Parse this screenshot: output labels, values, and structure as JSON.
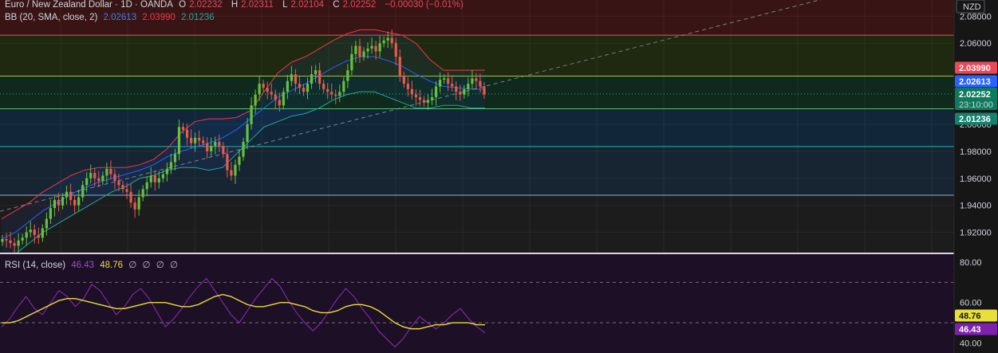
{
  "legend": {
    "symbol": "Euro / New Zealand Dollar · 1D · OANDA",
    "o_label": "O",
    "o_value": "2.02232",
    "h_label": "H",
    "h_value": "2.02311",
    "l_label": "L",
    "l_value": "2.02104",
    "c_label": "C",
    "c_value": "2.02252",
    "change": "−0.00030 (−0.01%)",
    "bb_label": "BB (20, SMA, close, 2)",
    "bb_basis": "2.02613",
    "bb_upper": "2.03990",
    "bb_lower": "2.01236",
    "rsi_label": "RSI (14, close)",
    "rsi_value": "46.43",
    "rsi_ma": "48.76",
    "rsi_extra": [
      "∅",
      "∅",
      "∅",
      "∅"
    ]
  },
  "axis": {
    "currency": "NZD",
    "price_ticks": [
      "2.08000",
      "2.06000",
      "2.00000",
      "1.98000",
      "1.96000",
      "1.94000",
      "1.92000"
    ],
    "rsi_ticks": [
      "80.00",
      "60.00",
      "40.00"
    ],
    "badges": {
      "upper": "2.03990",
      "basis": "2.02613",
      "close": "2.02252",
      "countdown": "23:10:00",
      "lower": "2.01236",
      "rsi_ma": "48.76",
      "rsi": "46.43"
    }
  },
  "colors": {
    "upper_band": "#f23645",
    "basis": "#2962ff",
    "lower_band": "#26a69a",
    "bull": "#66c23a",
    "bear": "#e85a4f",
    "rsi": "#8b2fb8",
    "rsi_ma": "#e8df3a",
    "zone_red": "#3a1414",
    "zone_olive": "#1f2a10",
    "zone_green": "#0f2a1c",
    "zone_teal": "#11273a",
    "rsi_bg": "#1d0f26"
  },
  "chart_data": [
    {
      "type": "candlestick",
      "title": "Euro / New Zealand Dollar · 1D · OANDA",
      "ylim": [
        1.905,
        2.092
      ],
      "y_ticks": [
        2.08,
        2.06,
        2.0,
        1.98,
        1.96,
        1.94,
        1.92
      ],
      "horizontal_levels": [
        2.066,
        2.0357,
        2.0115,
        1.9835,
        1.9475
      ],
      "trendline": {
        "from": [
          0,
          1.9355
        ],
        "to": [
          299,
          2.094
        ]
      },
      "close_series": [
        1.915,
        1.914,
        1.912,
        1.91,
        1.914,
        1.916,
        1.92,
        1.922,
        1.918,
        1.916,
        1.923,
        1.93,
        1.938,
        1.944,
        1.94,
        1.946,
        1.95,
        1.944,
        1.94,
        1.946,
        1.955,
        1.96,
        1.964,
        1.96,
        1.958,
        1.962,
        1.967,
        1.963,
        1.958,
        1.955,
        1.952,
        1.95,
        1.942,
        1.937,
        1.946,
        1.952,
        1.957,
        1.962,
        1.957,
        1.96,
        1.963,
        1.967,
        1.972,
        1.978,
        1.998,
        1.996,
        1.99,
        1.986,
        1.99,
        1.988,
        1.986,
        1.98,
        1.984,
        1.987,
        1.984,
        1.978,
        1.966,
        1.962,
        1.97,
        1.976,
        1.987,
        2.0,
        2.014,
        2.022,
        2.03,
        2.027,
        2.024,
        2.022,
        2.018,
        2.014,
        2.024,
        2.032,
        2.037,
        2.03,
        2.027,
        2.024,
        2.03,
        2.037,
        2.04,
        2.03,
        2.026,
        2.024,
        2.022,
        2.021,
        2.024,
        2.032,
        2.04,
        2.052,
        2.058,
        2.05,
        2.054,
        2.056,
        2.058,
        2.054,
        2.06,
        2.062,
        2.064,
        2.06,
        2.05,
        2.036,
        2.03,
        2.026,
        2.022,
        2.02,
        2.018,
        2.016,
        2.018,
        2.02,
        2.028,
        2.033,
        2.034,
        2.03,
        2.028,
        2.024,
        2.022,
        2.026,
        2.03,
        2.034,
        2.032,
        2.028,
        2.022
      ],
      "bollinger": {
        "upper": [
          1.93,
          1.936,
          1.942,
          1.95,
          1.956,
          1.962,
          1.966,
          1.968,
          1.968,
          1.968,
          1.97,
          1.974,
          1.982,
          1.994,
          2.002,
          2.004,
          2.004,
          2.005,
          2.01,
          2.024,
          2.038,
          2.046,
          2.05,
          2.056,
          2.062,
          2.067,
          2.07,
          2.07,
          2.068,
          2.066,
          2.06,
          2.048,
          2.04,
          2.04,
          2.04,
          2.04
        ],
        "basis": [
          1.915,
          1.92,
          1.928,
          1.936,
          1.942,
          1.948,
          1.953,
          1.957,
          1.96,
          1.963,
          1.966,
          1.97,
          1.976,
          1.98,
          1.983,
          1.986,
          1.99,
          1.996,
          2.004,
          2.012,
          2.02,
          2.025,
          2.03,
          2.036,
          2.042,
          2.047,
          2.05,
          2.05,
          2.047,
          2.043,
          2.037,
          2.032,
          2.028,
          2.027,
          2.026,
          2.026
        ],
        "lower": [
          1.9,
          1.904,
          1.912,
          1.92,
          1.926,
          1.932,
          1.938,
          1.944,
          1.95,
          1.954,
          1.96,
          1.962,
          1.966,
          1.968,
          1.968,
          1.966,
          1.968,
          1.978,
          1.988,
          1.998,
          2.002,
          2.006,
          2.008,
          2.012,
          2.018,
          2.022,
          2.024,
          2.024,
          2.02,
          2.016,
          2.012,
          2.012,
          2.014,
          2.014,
          2.012,
          2.012
        ]
      }
    },
    {
      "type": "line",
      "title": "RSI (14, close)",
      "ylim": [
        35,
        84
      ],
      "y_ticks": [
        80,
        60,
        40
      ],
      "levels": [
        70,
        50
      ],
      "series": [
        {
          "name": "RSI",
          "values": [
            48,
            52,
            58,
            63,
            57,
            54,
            60,
            66,
            63,
            58,
            62,
            69,
            66,
            60,
            54,
            58,
            64,
            67,
            62,
            55,
            48,
            52,
            57,
            63,
            68,
            72,
            66,
            60,
            54,
            50,
            56,
            62,
            67,
            72,
            68,
            61,
            55,
            50,
            46,
            50,
            56,
            62,
            67,
            63,
            57,
            52,
            46,
            42,
            38,
            42,
            48,
            53,
            50,
            47,
            50,
            54,
            57,
            52,
            48,
            45
          ]
        },
        {
          "name": "RSI-based MA",
          "values": [
            50,
            50,
            51,
            53,
            55,
            57,
            59,
            61,
            62,
            62,
            61,
            60,
            59,
            58,
            57,
            57,
            58,
            59,
            60,
            60,
            60,
            59,
            58,
            58,
            59,
            61,
            63,
            64,
            63,
            61,
            59,
            58,
            58,
            59,
            60,
            60,
            59,
            58,
            56,
            55,
            55,
            56,
            58,
            59,
            59,
            58,
            56,
            53,
            50,
            48,
            47,
            47,
            48,
            49,
            49,
            50,
            50,
            50,
            49,
            49
          ]
        }
      ]
    }
  ]
}
